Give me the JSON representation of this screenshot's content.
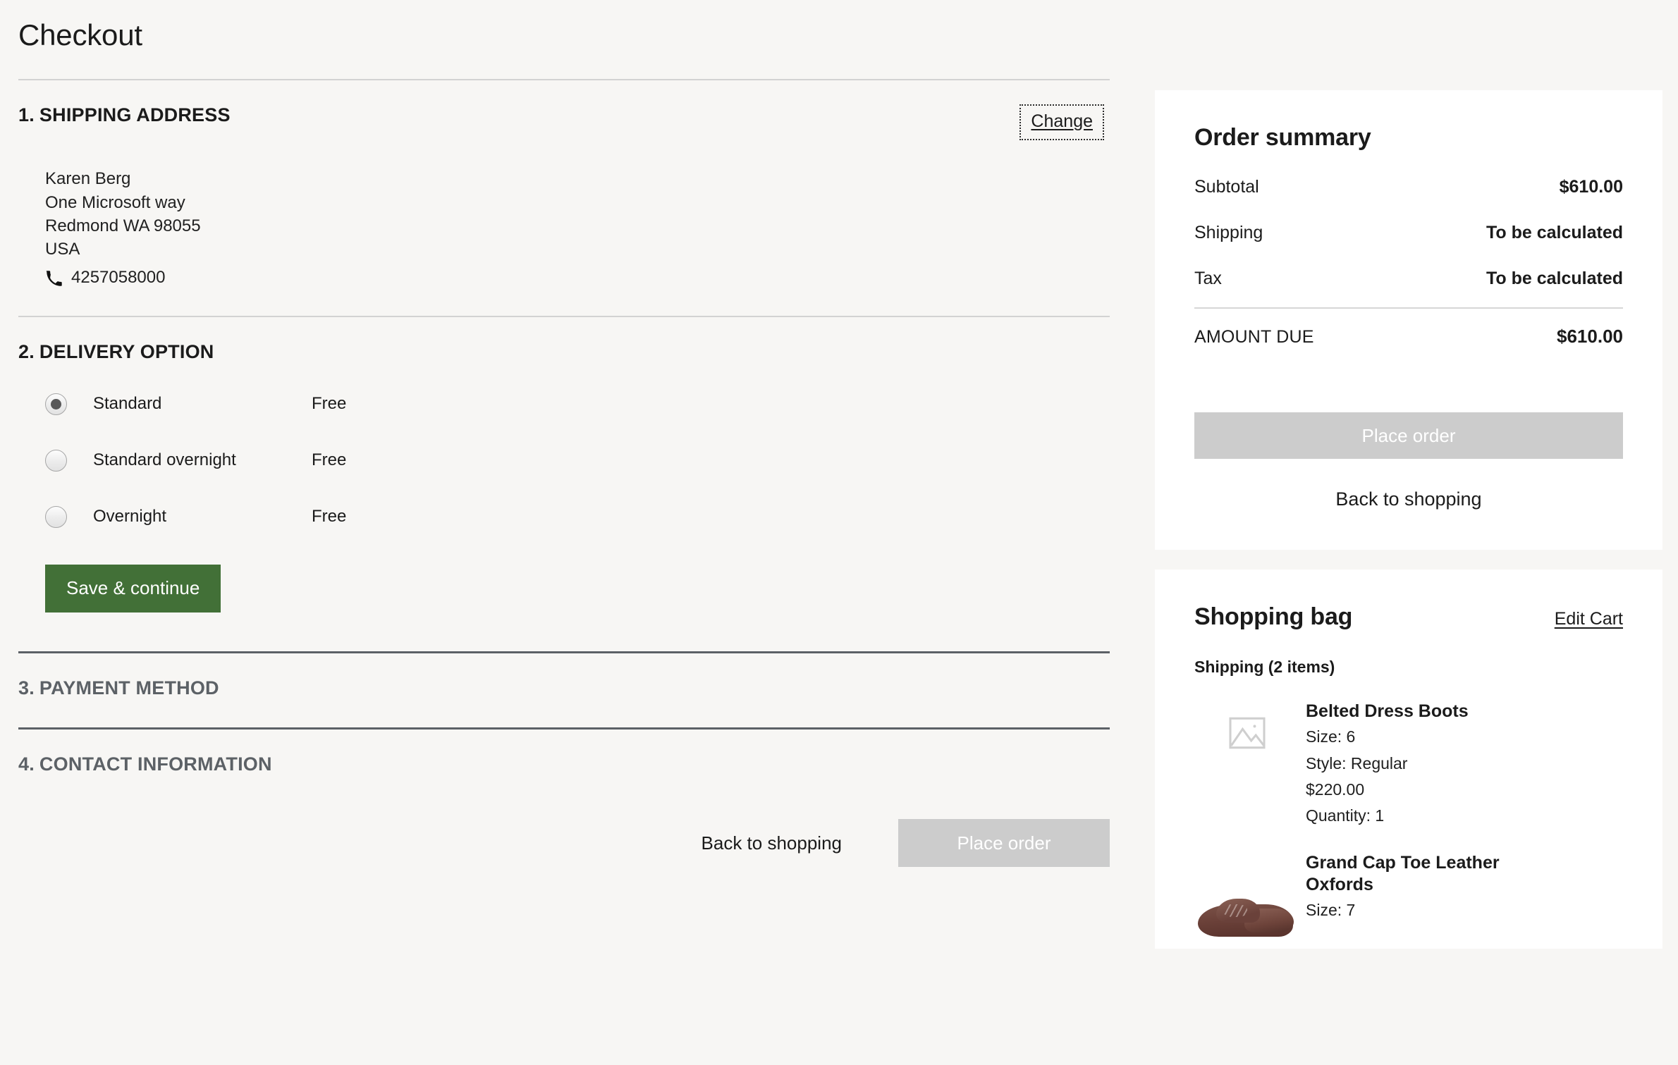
{
  "page": {
    "title": "Checkout",
    "background_color": "#F7F6F4",
    "accent_green": "#427037",
    "disabled_grey": "#CCCCCC"
  },
  "sections": {
    "shipping": {
      "number": "1.",
      "title": "SHIPPING ADDRESS",
      "change_label": "Change",
      "address": {
        "name": "Karen Berg",
        "street": "One Microsoft way",
        "city_state_zip": "Redmond WA  98055",
        "country": "USA",
        "phone": "4257058000",
        "phone_icon": "phone-icon"
      }
    },
    "delivery": {
      "number": "2.",
      "title": "DELIVERY OPTION",
      "options": [
        {
          "label": "Standard",
          "price": "Free",
          "selected": true
        },
        {
          "label": "Standard overnight",
          "price": "Free",
          "selected": false
        },
        {
          "label": "Overnight",
          "price": "Free",
          "selected": false
        }
      ],
      "save_label": "Save & continue"
    },
    "payment": {
      "number": "3.",
      "title": "PAYMENT METHOD"
    },
    "contact": {
      "number": "4.",
      "title": "CONTACT INFORMATION"
    }
  },
  "footer": {
    "back_label": "Back to shopping",
    "place_order_label": "Place order"
  },
  "order_summary": {
    "title": "Order summary",
    "rows": [
      {
        "label": "Subtotal",
        "value": "$610.00"
      },
      {
        "label": "Shipping",
        "value": "To be calculated"
      },
      {
        "label": "Tax",
        "value": "To be calculated"
      }
    ],
    "total_label": "AMOUNT DUE",
    "total_value": "$610.00",
    "place_order_label": "Place order",
    "back_label": "Back to shopping"
  },
  "shopping_bag": {
    "title": "Shopping bag",
    "edit_label": "Edit Cart",
    "group_label": "Shipping (2 items)",
    "items": [
      {
        "name": "Belted Dress Boots",
        "size": "Size: 6",
        "style": "Style: Regular",
        "price": "$220.00",
        "quantity": "Quantity: 1",
        "thumb": "image-placeholder-icon"
      },
      {
        "name": "Grand Cap Toe Leather Oxfords",
        "size": "Size: 7",
        "thumb": "brown-oxford-shoe-photo"
      }
    ]
  }
}
